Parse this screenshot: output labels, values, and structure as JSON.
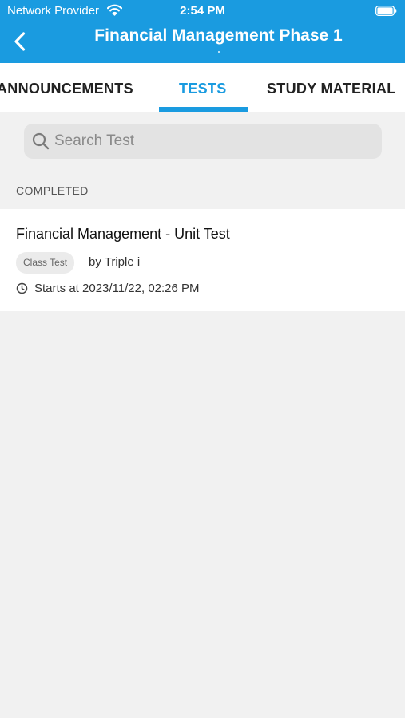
{
  "status_bar": {
    "carrier": "Network Provider",
    "time": "2:54 PM",
    "icons": [
      "wifi-icon",
      "battery-icon"
    ]
  },
  "header": {
    "title": "Financial Management Phase 1",
    "back_icon": "chevron-left-icon",
    "background_color": "#1a9be0"
  },
  "tabs": [
    {
      "label": "ANNOUNCEMENTS",
      "active": false
    },
    {
      "label": "TESTS",
      "active": true
    },
    {
      "label": "STUDY MATERIAL",
      "active": false
    }
  ],
  "search": {
    "placeholder": "Search Test",
    "value": "",
    "icon": "search-icon"
  },
  "section": {
    "label": "COMPLETED"
  },
  "tests": [
    {
      "title": "Financial Management - Unit Test",
      "badge": "Class Test",
      "author": "by Triple i",
      "start": "Starts at 2023/11/22, 02:26 PM",
      "icon": "clock-icon"
    }
  ],
  "colors": {
    "accent": "#1a9be0",
    "background": "#f1f1f1"
  }
}
